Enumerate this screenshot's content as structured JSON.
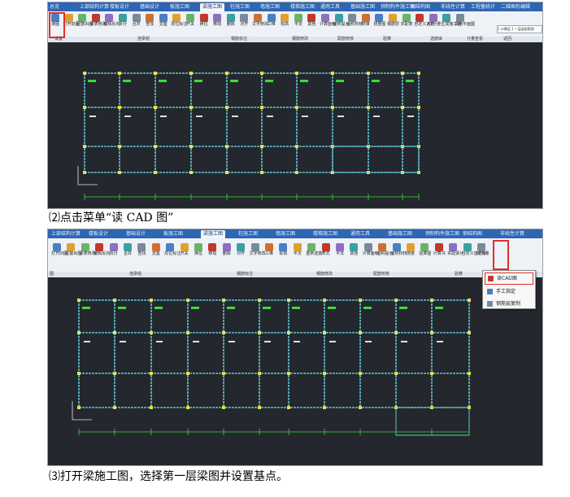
{
  "screenshot1": {
    "tabs": [
      {
        "label": "总览",
        "active": false
      },
      {
        "label": "上部结构计算",
        "active": false
      },
      {
        "label": "楼板设计",
        "active": false
      },
      {
        "label": "基础设计",
        "active": false
      },
      {
        "label": "板施工图",
        "active": false
      },
      {
        "label": "梁施工图",
        "active": true
      },
      {
        "label": "柱施工图",
        "active": false
      },
      {
        "label": "墙施工图",
        "active": false
      },
      {
        "label": "楼梯施工图",
        "active": false
      },
      {
        "label": "通用工具",
        "active": false
      },
      {
        "label": "基础施工图",
        "active": false
      },
      {
        "label": "预制构件施工图",
        "active": false
      },
      {
        "label": "钢结构图",
        "active": false
      },
      {
        "label": "非线性计算",
        "active": false
      },
      {
        "label": "工程量统计",
        "active": false
      },
      {
        "label": "二维图形编辑",
        "active": false
      }
    ],
    "buttons": [
      "读图",
      "打开旧图",
      "配筋出图",
      "梁表修改",
      "编辑反向",
      "拆分",
      "合并",
      "查找",
      "支座",
      "原位标注",
      "开关",
      "换位",
      "移动",
      "删除",
      "对齐",
      "文字修改",
      "三维",
      "标高",
      "平法",
      "其他",
      "计算面积",
      "面积提示",
      "面积校核",
      "校审",
      "挠度图",
      "钢筋层",
      "实配表",
      "自定义选筋",
      "XY分量",
      "生成施工图",
      "调用平面图"
    ],
    "groups": [
      "设置",
      "连梁组",
      "钢筋标注",
      "钢筋修改",
      "配筋校核",
      "验算",
      "选筋库",
      "分量查看",
      "返回"
    ],
    "quick_input": "1 计算层 1 ～层梁配筋图"
  },
  "caption1": "⑵点击菜单“读 CAD 图”",
  "screenshot2": {
    "tabs": [
      {
        "label": "上部结构计算",
        "active": false
      },
      {
        "label": "楼板设计",
        "active": false
      },
      {
        "label": "基础设计",
        "active": false
      },
      {
        "label": "板施工图",
        "active": false
      },
      {
        "label": "梁施工图",
        "active": true
      },
      {
        "label": "柱施工图",
        "active": false
      },
      {
        "label": "墙施工图",
        "active": false
      },
      {
        "label": "楼梯施工图",
        "active": false
      },
      {
        "label": "通用工具",
        "active": false
      },
      {
        "label": "基础施工图",
        "active": false
      },
      {
        "label": "预制构件施工图",
        "active": false
      },
      {
        "label": "钢结构图",
        "active": false
      },
      {
        "label": "非线性计算",
        "active": false
      }
    ],
    "buttons": [
      "打开旧图",
      "配筋出图",
      "梁表修改",
      "编辑反向",
      "拆分",
      "合并",
      "查找",
      "支座",
      "原位标注",
      "开关",
      "换位",
      "移动",
      "删除",
      "对齐",
      "文字修改",
      "三维",
      "标高",
      "平法",
      "重新选筋",
      "表式",
      "平法",
      "其他",
      "计算面积",
      "面积提示",
      "面积校核",
      "挠度",
      "验算图",
      "计算书",
      "实配梁计",
      "自定义选筋库",
      "XY分量"
    ],
    "groups": [
      "图",
      "连梁组",
      "钢筋标注",
      "钢筋修改",
      "配筋校核",
      "验算",
      "分量"
    ],
    "context_menu": [
      "读CAD图",
      "手工指定",
      "钢筋层复制"
    ]
  },
  "caption2": "⑶打开梁施工图，选择第一层梁图并设置基点。",
  "colors": {
    "tab_bar": "#2e66b3",
    "canvas": "#24272d",
    "beam_line": "#5fc7d6",
    "column": "#e8e04a",
    "rebar_label": "#3ddb3d",
    "highlight": "#e0302a"
  }
}
